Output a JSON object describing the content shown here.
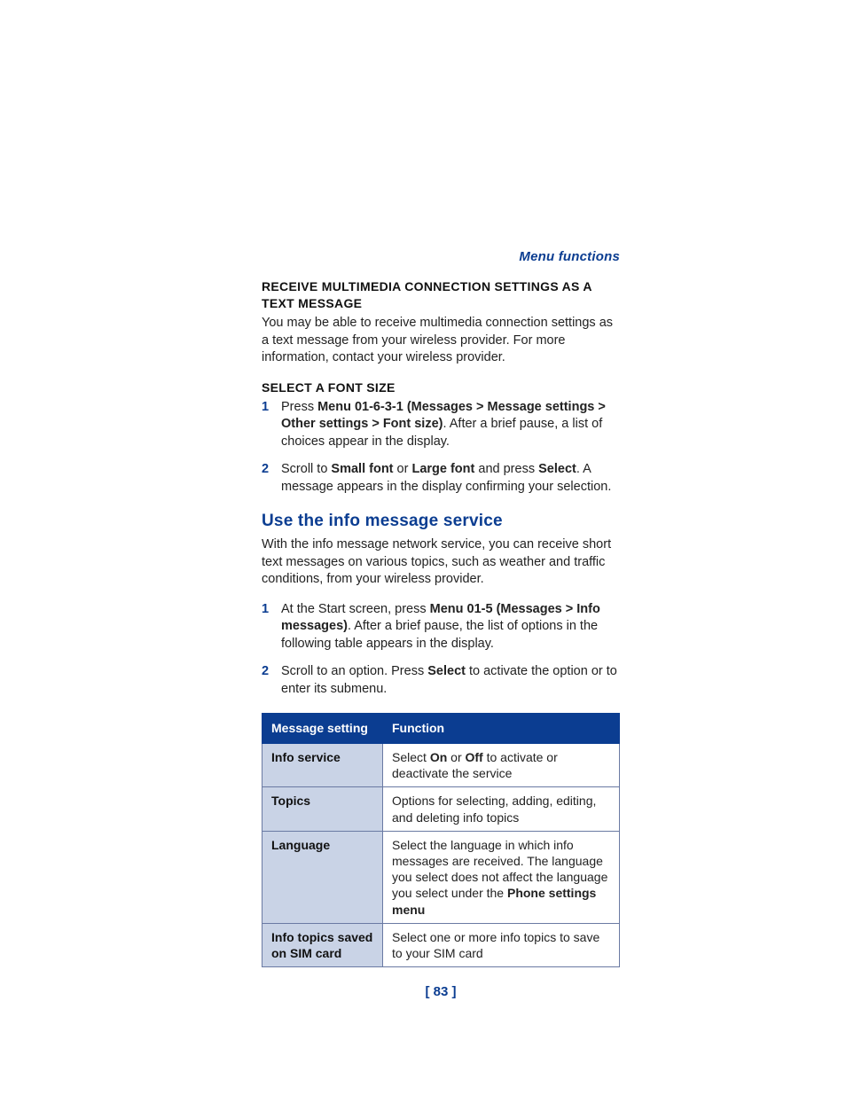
{
  "header": {
    "section": "Menu functions"
  },
  "section1": {
    "title": "RECEIVE MULTIMEDIA CONNECTION SETTINGS AS A TEXT MESSAGE",
    "body": "You may be able to receive multimedia connection settings as a text message from your wireless provider. For more information, contact your wireless provider."
  },
  "section2": {
    "title": "SELECT A FONT SIZE",
    "steps": [
      {
        "num": "1",
        "pre": "Press ",
        "bold1": "Menu 01-6-3-1 (Messages > Message settings > Other settings > Font size)",
        "post": ". After a brief pause, a list of choices appear in the display."
      },
      {
        "num": "2",
        "pre": "Scroll to ",
        "bold1": "Small font",
        "mid1": " or ",
        "bold2": "Large font",
        "mid2": " and press ",
        "bold3": "Select",
        "post": ". A message appears in the display confirming your selection."
      }
    ]
  },
  "section3": {
    "title": "Use the info message service",
    "intro": "With the info message network service, you can receive short text messages on various topics, such as weather and traffic conditions, from your wireless provider.",
    "steps": [
      {
        "num": "1",
        "pre": "At the Start screen, press ",
        "bold1": "Menu 01-5 (Messages > Info messages)",
        "post": ". After a brief pause, the list of options in the following table appears in the display."
      },
      {
        "num": "2",
        "pre": "Scroll to an option. Press ",
        "bold1": "Select",
        "post": " to activate the option or to enter its submenu."
      }
    ]
  },
  "table": {
    "header": {
      "col1": "Message setting",
      "col2": "Function"
    },
    "rows": [
      {
        "label": "Info service",
        "pre": "Select ",
        "bold1": "On",
        "mid1": " or ",
        "bold2": "Off",
        "post": " to activate or deactivate the service"
      },
      {
        "label": "Topics",
        "plain": "Options for selecting, adding, editing, and deleting info topics"
      },
      {
        "label": "Language",
        "pre": "Select the language in which info messages are received. The language you select does not affect the language you select under the ",
        "bold1": "Phone settings menu"
      },
      {
        "label": "Info topics saved on SIM card",
        "plain": "Select one or more info topics to save to your SIM card"
      }
    ]
  },
  "pagenum": "[ 83 ]"
}
